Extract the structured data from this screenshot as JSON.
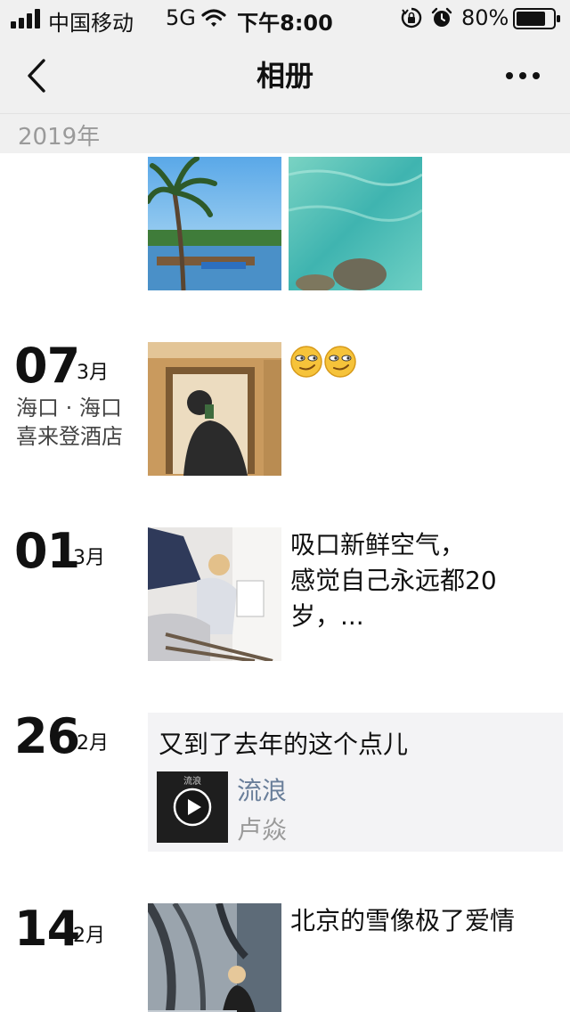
{
  "status_bar": {
    "carrier": "中国移动",
    "network": "5G",
    "time": "下午8:00",
    "battery": "80%",
    "battery_level": 0.8,
    "icons": [
      "signal-icon",
      "wifi-icon",
      "orientation-lock-icon",
      "alarm-icon",
      "battery-icon"
    ]
  },
  "nav": {
    "title": "相册",
    "back_icon": "chevron-left-icon",
    "more_icon": "more-dots-icon"
  },
  "year_label": "2019年",
  "posts": [
    {
      "day": "07",
      "month": "3月",
      "location_line1": "海口 · 海口",
      "location_line2": "喜来登酒店",
      "text": "😏😏",
      "photo": "mirror-selfie-photo"
    },
    {
      "day": "01",
      "month": "3月",
      "text_line1": "吸口新鲜空气，",
      "text_line2": "感觉自己永远都20",
      "text_line3": "岁，...",
      "photo": "balcony-photo"
    },
    {
      "day": "26",
      "month": "2月",
      "share": {
        "title": "又到了去年的这个点儿",
        "song": "流浪",
        "artist": "卢焱",
        "cover_text": "流浪"
      }
    },
    {
      "day": "14",
      "month": "2月",
      "text": "北京的雪像极了爱情",
      "photo": "city-snow-photo"
    }
  ],
  "colors": {
    "header_bg": "#f0f0f0",
    "year_text": "#9a9a9a",
    "song_title": "#6a7f9a",
    "card_bg": "#f3f3f5"
  }
}
